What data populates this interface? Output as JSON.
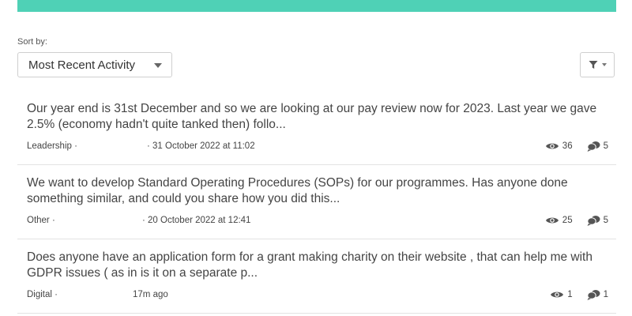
{
  "sort": {
    "label": "Sort by:",
    "selected": "Most Recent Activity"
  },
  "icons": {
    "filter": "filter-icon",
    "views": "eye-icon",
    "replies": "speech-bubbles-icon"
  },
  "colors": {
    "accent_bar": "#4fd1b6"
  },
  "posts": [
    {
      "text": "Our year end is 31st December and so we are looking at our pay review now for 2023. Last year we gave 2.5% (economy hadn't quite tanked then) follo...",
      "category": "Leadership ·",
      "date": "· 31 October 2022 at 11:02",
      "views": "36",
      "replies": "5"
    },
    {
      "text": "We want to develop Standard Operating Procedures (SOPs) for our programmes. Has anyone done something similar, and could you share how you did this...",
      "category": "Other ·",
      "date": "· 20 October 2022 at 12:41",
      "views": "25",
      "replies": "5"
    },
    {
      "text": "Does anyone have an application form for a grant making charity on their website , that can help me with GDPR issues ( as in is it on a separate p...",
      "category": "Digital ·",
      "date": "17m ago",
      "views": "1",
      "replies": "1"
    }
  ]
}
